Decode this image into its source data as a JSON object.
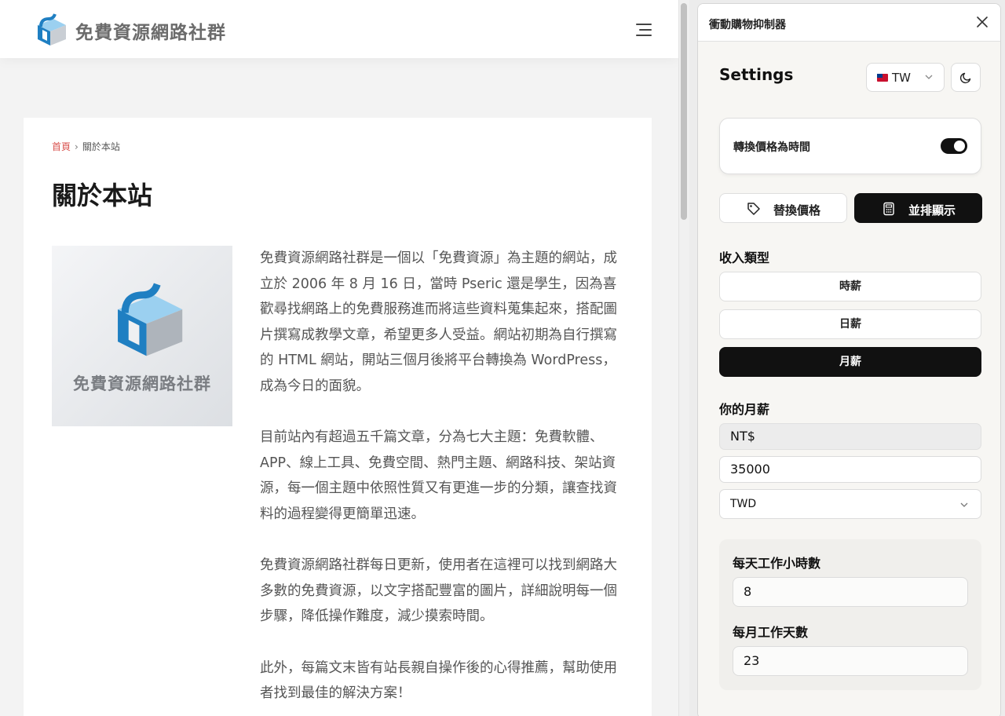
{
  "site": {
    "title": "免費資源網路社群",
    "breadcrumb": {
      "home": "首頁",
      "separator": "›",
      "current": "關於本站"
    },
    "page_title": "關於本站",
    "image_caption": "免費資源網路社群",
    "paragraphs": [
      "免費資源網路社群是一個以「免費資源」為主題的網站，成立於 2006 年 8 月 16 日，當時 Pseric 還是學生，因為喜歡尋找網路上的免費服務進而將這些資料蒐集起來，搭配圖片撰寫成教學文章，希望更多人受益。網站初期為自行撰寫的 HTML 網站，開站三個月後將平台轉換為 WordPress，成為今日的面貌。",
      "目前站內有超過五千篇文章，分為七大主題：免費軟體、APP、線上工具、免費空間、熱門主題、網路科技、架站資源，每一個主題中依照性質又有更進一步的分類，讓查找資料的過程變得更簡單迅速。",
      "免費資源網路社群每日更新，使用者在這裡可以找到網路大多數的免費資源，以文字搭配豐富的圖片，詳細說明每一個步驟，降低操作難度，減少摸索時間。",
      "此外，每篇文末皆有站長親自操作後的心得推薦，幫助使用者找到最佳的解決方案！"
    ]
  },
  "panel": {
    "title": "衝動購物抑制器",
    "settings_title": "Settings",
    "country": "TW",
    "toggle_label": "轉換價格為時間",
    "toggle_on": true,
    "modes": {
      "replace": "替換價格",
      "side_by_side": "並排顯示"
    },
    "income_type_label": "收入類型",
    "income_types": [
      "時薪",
      "日薪",
      "月薪"
    ],
    "income_selected": "月薪",
    "salary_label": "你的月薪",
    "currency_symbol": "NT$",
    "salary_value": "35000",
    "currency_code": "TWD",
    "hours_label": "每天工作小時數",
    "hours_value": "8",
    "days_label": "每月工作天數",
    "days_value": "23"
  },
  "colors": {
    "accent_link": "#d9534f",
    "dark_button": "#111111",
    "logo_blue": "#1f7fc2"
  }
}
